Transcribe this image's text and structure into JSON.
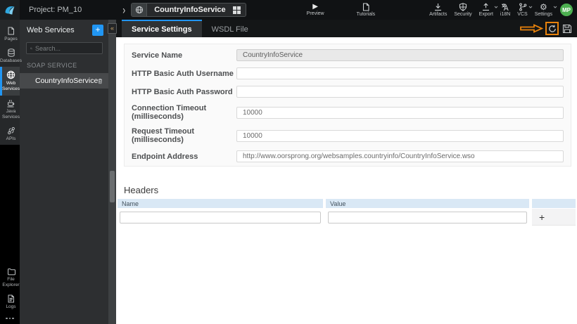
{
  "topbar": {
    "project_label": "Project: PM_10",
    "service_pill": {
      "name": "CountryInfoService"
    },
    "preview_label": "Preview",
    "tutorials_label": "Tutorials",
    "actions": [
      {
        "label": "Artifacts",
        "icon": "download-icon"
      },
      {
        "label": "Security",
        "icon": "shield-icon"
      },
      {
        "label": "Export",
        "icon": "upload-icon",
        "chevron": true
      },
      {
        "label": "i18N",
        "icon": "translate-icon"
      },
      {
        "label": "VCS",
        "icon": "branch-icon",
        "chevron": true
      },
      {
        "label": "Settings",
        "icon": "gear-icon",
        "chevron": true
      }
    ],
    "avatar_initials": "MP",
    "avatar_color": "#4caf50"
  },
  "rail": {
    "items": [
      {
        "label": "Pages",
        "icon": "page-icon"
      },
      {
        "label": "Databases",
        "icon": "database-icon"
      },
      {
        "label": "Web Services",
        "icon": "globe-icon",
        "active": true
      },
      {
        "label": "Java Services",
        "icon": "coffee-icon"
      },
      {
        "label": "APIs",
        "icon": "api-icon"
      }
    ],
    "bottom_items": [
      {
        "label": "File Explorer",
        "icon": "folder-icon"
      },
      {
        "label": "Logs",
        "icon": "log-icon"
      }
    ],
    "more_icon": "ellipsis-icon",
    "accent_color": "#2196f3"
  },
  "panel": {
    "title": "Web Services",
    "add_button": "+",
    "search_placeholder": "Search...",
    "section_label": "SOAP SERVICE",
    "service_item": "CountryInfoService",
    "collapse_glyph": "«"
  },
  "tabs": [
    {
      "label": "Service Settings",
      "active": true
    },
    {
      "label": "WSDL File",
      "active": false
    }
  ],
  "tab_actions": {
    "annotation_color": "#e8820c",
    "refresh_icon": "refresh-icon",
    "save_icon": "save-icon"
  },
  "form": {
    "fields": [
      {
        "label": "Service Name",
        "value": "CountryInfoService",
        "disabled": true
      },
      {
        "label": "HTTP Basic Auth Username",
        "value": ""
      },
      {
        "label": "HTTP Basic Auth Password",
        "value": ""
      },
      {
        "label": "Connection Timeout (milliseconds)",
        "value": "10000"
      },
      {
        "label": "Request Timeout (milliseconds)",
        "value": "10000"
      },
      {
        "label": "Endpoint Address",
        "value": "http://www.oorsprong.org/websamples.countryinfo/CountryInfoService.wso"
      }
    ]
  },
  "headers_section": {
    "title": "Headers",
    "columns": [
      "Name",
      "Value"
    ],
    "add_label": "+",
    "header_bg": "#d9e8f5",
    "row": {
      "name_value": "",
      "value_value": ""
    }
  }
}
